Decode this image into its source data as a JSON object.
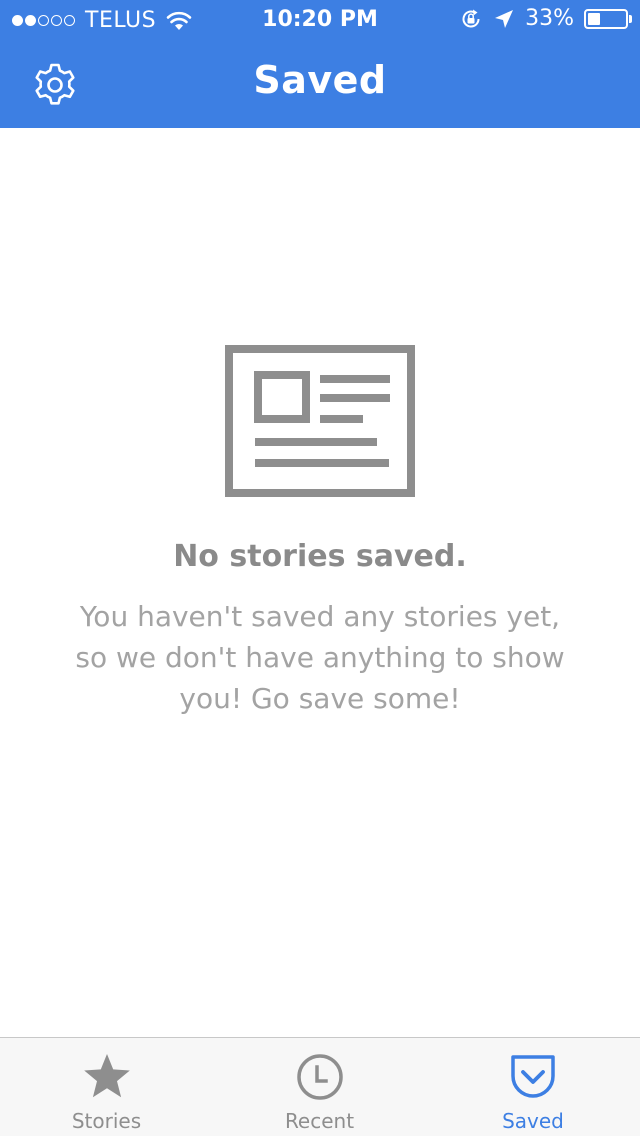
{
  "status_bar": {
    "carrier": "TELUS",
    "time": "10:20 PM",
    "battery_percent": "33%",
    "battery_level": 0.33,
    "signal_bars_filled": 2,
    "signal_bars_total": 5
  },
  "nav": {
    "title": "Saved",
    "settings_icon": "gear-icon"
  },
  "empty_state": {
    "icon": "newspaper-icon",
    "title": "No stories saved.",
    "message": "You haven't saved any stories yet, so we don't have anything to show you! Go save some!"
  },
  "tabs": [
    {
      "label": "Stories",
      "icon": "star-icon",
      "active": false
    },
    {
      "label": "Recent",
      "icon": "clock-icon",
      "active": false
    },
    {
      "label": "Saved",
      "icon": "pocket-icon",
      "active": true
    }
  ],
  "colors": {
    "accent": "#3d7fe3",
    "inactive_icon": "#8e8e8e",
    "empty_text": "#a3a3a3"
  }
}
